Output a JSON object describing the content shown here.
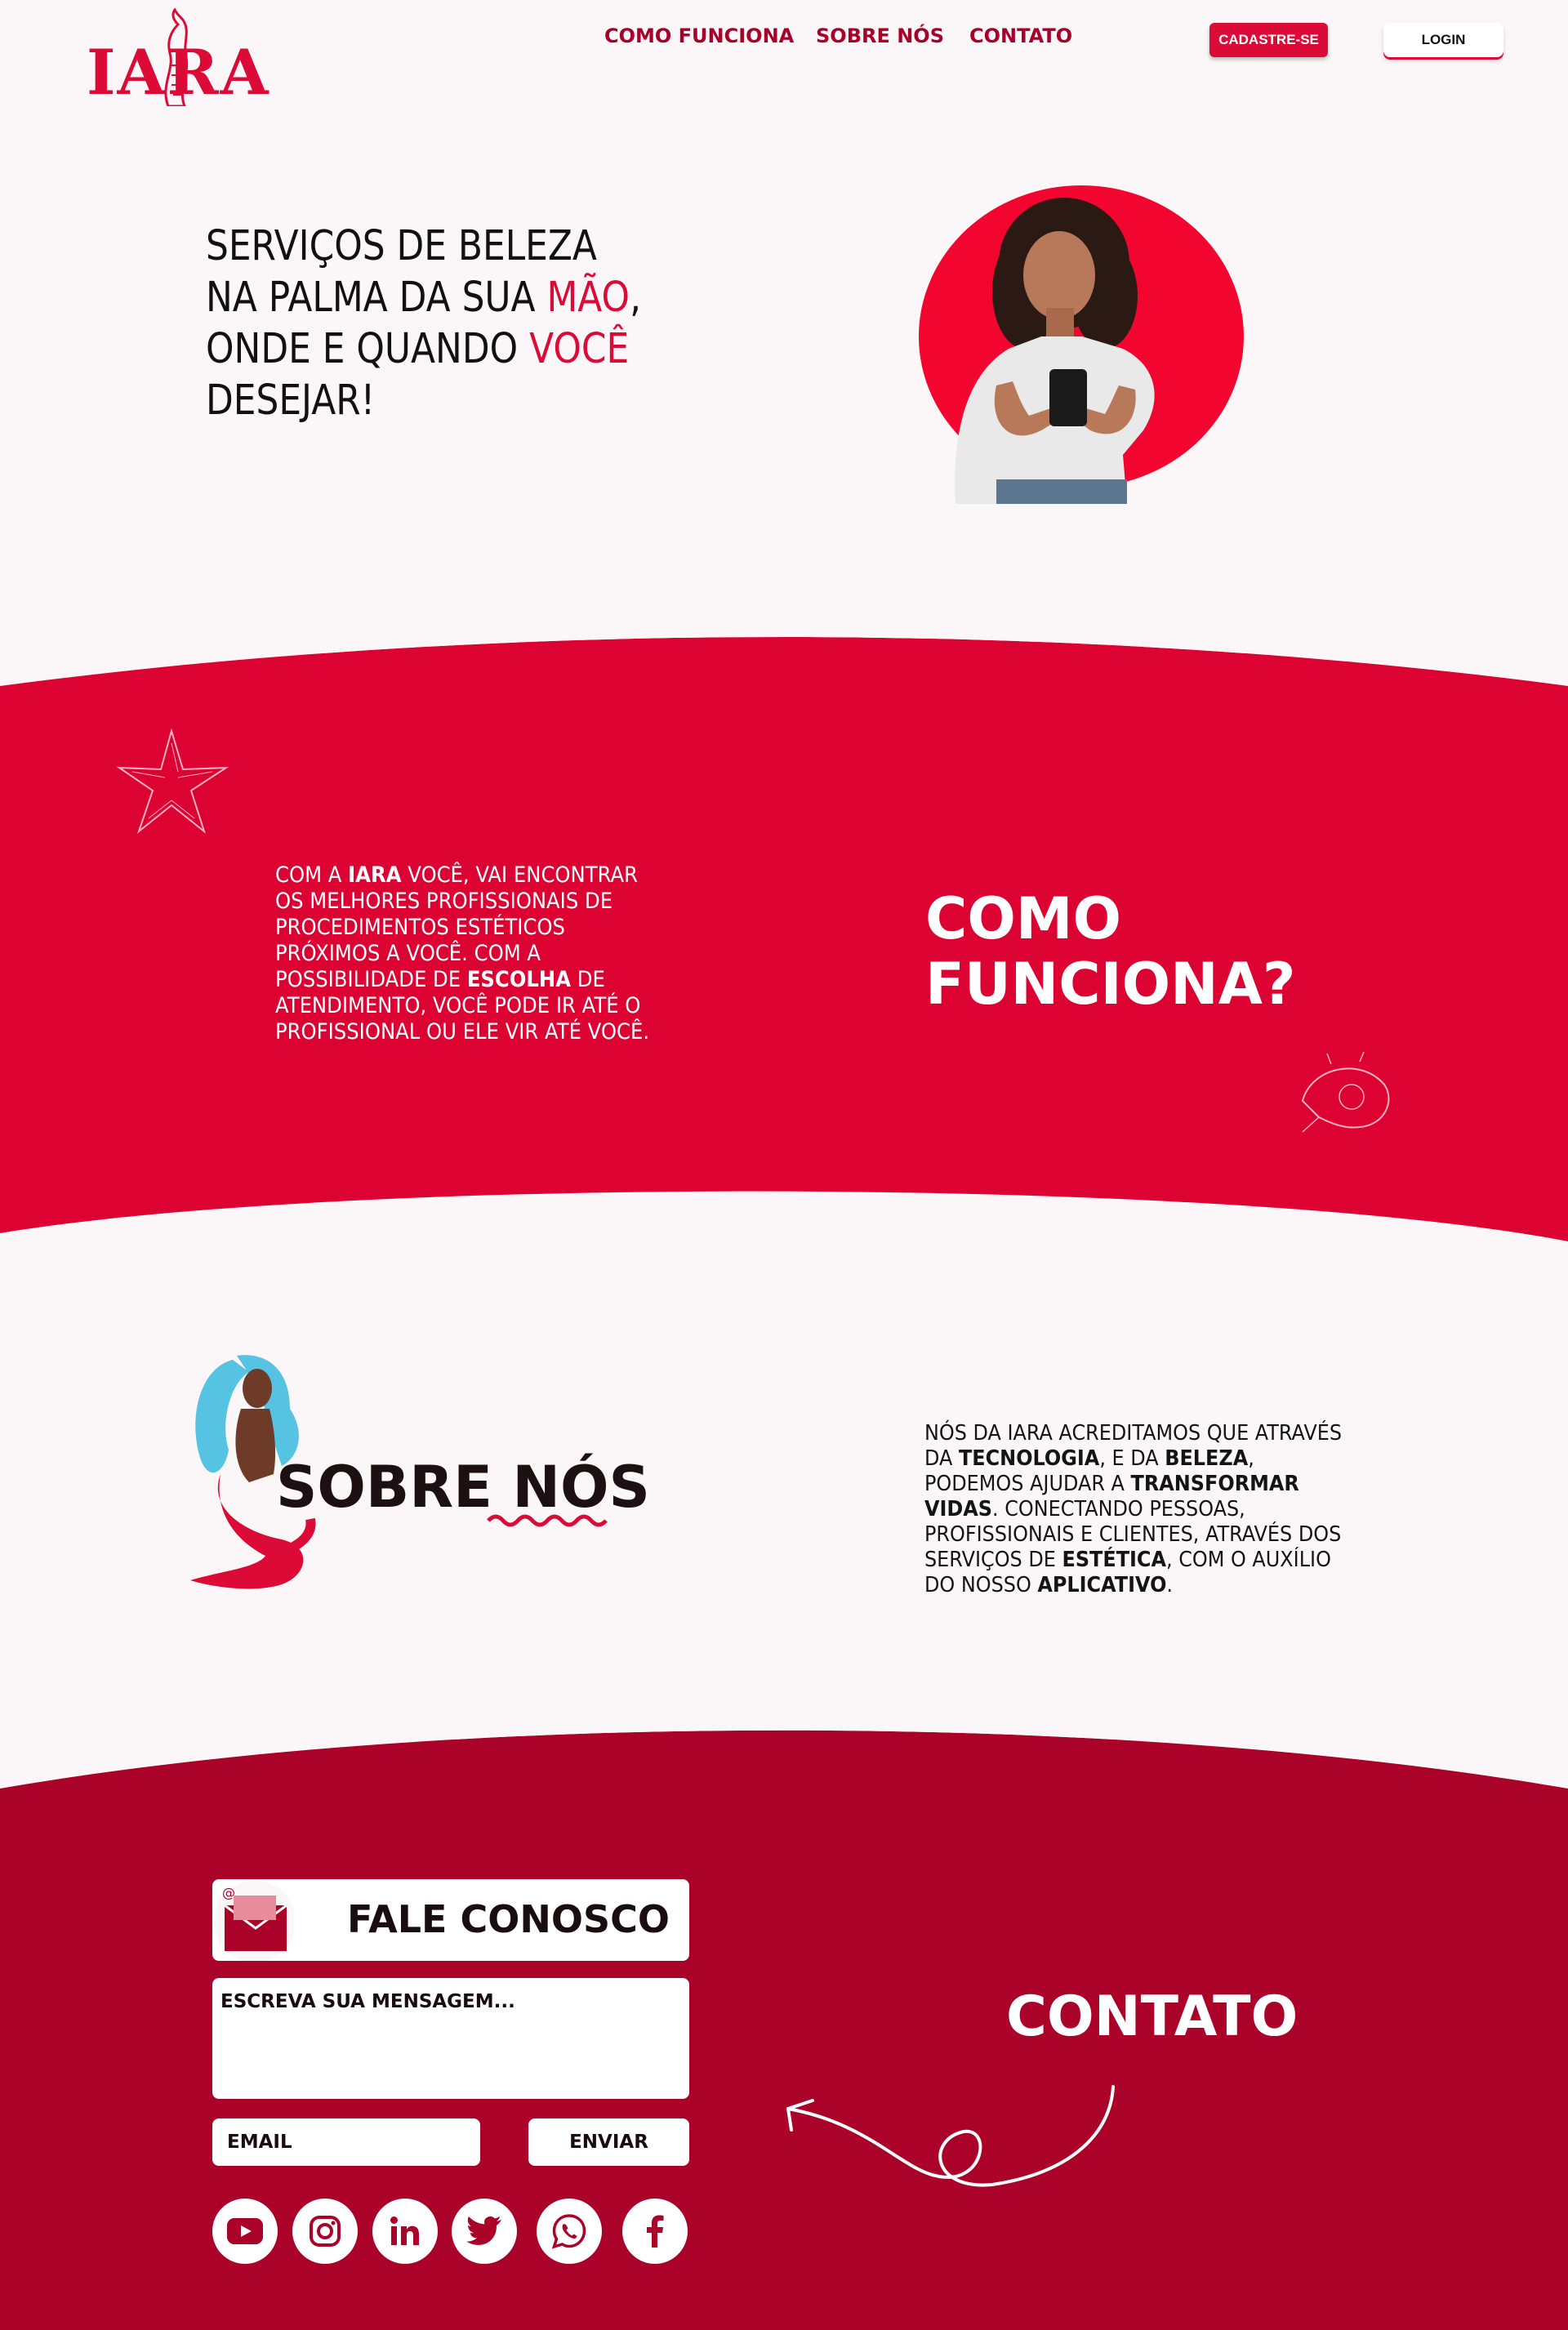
{
  "brand": {
    "logo_text": "IARA"
  },
  "nav": {
    "links": [
      "COMO FUNCIONA",
      "SOBRE NÓS",
      "CONTATO"
    ],
    "signup_label": "CADASTRE-SE",
    "login_label": "LOGIN"
  },
  "hero": {
    "line1": "SERVIÇOS DE BELEZA",
    "line2_pre": "NA PALMA DA SUA ",
    "line2_accent": "MÃO",
    "line2_post": ",",
    "line3_pre": "ONDE E QUANDO ",
    "line3_accent": "VOCÊ",
    "line4": "DESEJAR!"
  },
  "como_funciona": {
    "title_line1": "COMO",
    "title_line2": "FUNCIONA?",
    "text_1": "COM A ",
    "text_iara": "IARA",
    "text_2": " VOCÊ, VAI ENCONTRAR OS MELHORES PROFISSIONAIS DE PROCEDIMENTOS ESTÉTICOS PRÓXIMOS A VOCÊ. COM A POSSIBILIDADE DE ",
    "text_escolha": "ESCOLHA",
    "text_3": " DE ATENDIMENTO, VOCÊ PODE IR ATÉ O PROFISSIONAL OU ELE VIR ATÉ VOCÊ."
  },
  "sobre_nos": {
    "title": "SOBRE NÓS",
    "t1": "NÓS DA IARA ACREDITAMOS QUE ATRAVÉS DA ",
    "b1": "TECNOLOGIA",
    "t2": ", E DA ",
    "b2": "BELEZA",
    "t3": ", PODEMOS AJUDAR A ",
    "b3": "TRANSFORMAR VIDAS",
    "t4": ". CONECTANDO PESSOAS, PROFISSIONAIS E CLIENTES, ATRAVÉS DOS  SERVIÇOS DE ",
    "b4": "ESTÉTICA",
    "t5": ", COM O AUXÍLIO DO NOSSO ",
    "b5": "APLICATIVO",
    "t6": "."
  },
  "contato": {
    "title": "CONTATO",
    "form_title": "FALE CONOSCO",
    "message_placeholder": "ESCREVA SUA MENSAGEM...",
    "email_placeholder": "EMAIL",
    "send_label": "ENVIAR",
    "social_icons": [
      "youtube-icon",
      "instagram-icon",
      "linkedin-icon",
      "twitter-icon",
      "whatsapp-icon",
      "facebook-icon"
    ]
  },
  "colors": {
    "primary_red": "#dc0333",
    "dark_red": "#aa0228",
    "nav_text": "#a80028",
    "page_bg": "#fbf7f8"
  }
}
